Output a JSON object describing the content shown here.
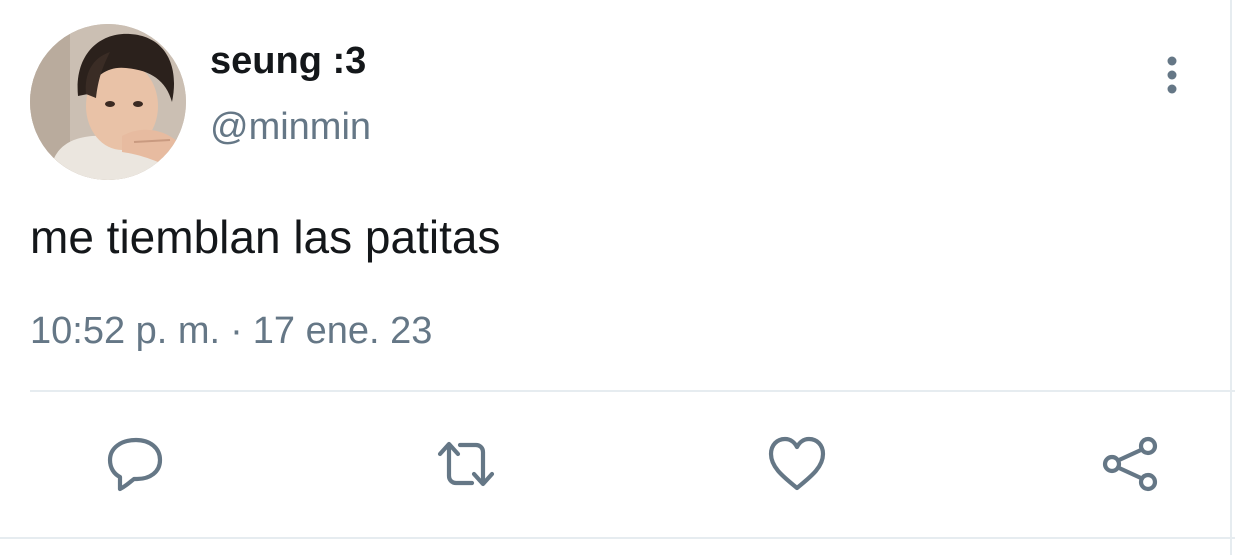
{
  "user": {
    "display_name": "seung :3",
    "handle": "@minmin"
  },
  "tweet": {
    "text": "me tiemblan las patitas",
    "time": "10:52 p. m.",
    "separator": "·",
    "date": "17 ene. 23"
  },
  "icons": {
    "more": "more-vertical-icon",
    "reply": "reply-icon",
    "retweet": "retweet-icon",
    "like": "heart-icon",
    "share": "share-icon"
  },
  "colors": {
    "text": "#14171a",
    "secondary": "#657786",
    "divider": "#e6ecf0"
  }
}
